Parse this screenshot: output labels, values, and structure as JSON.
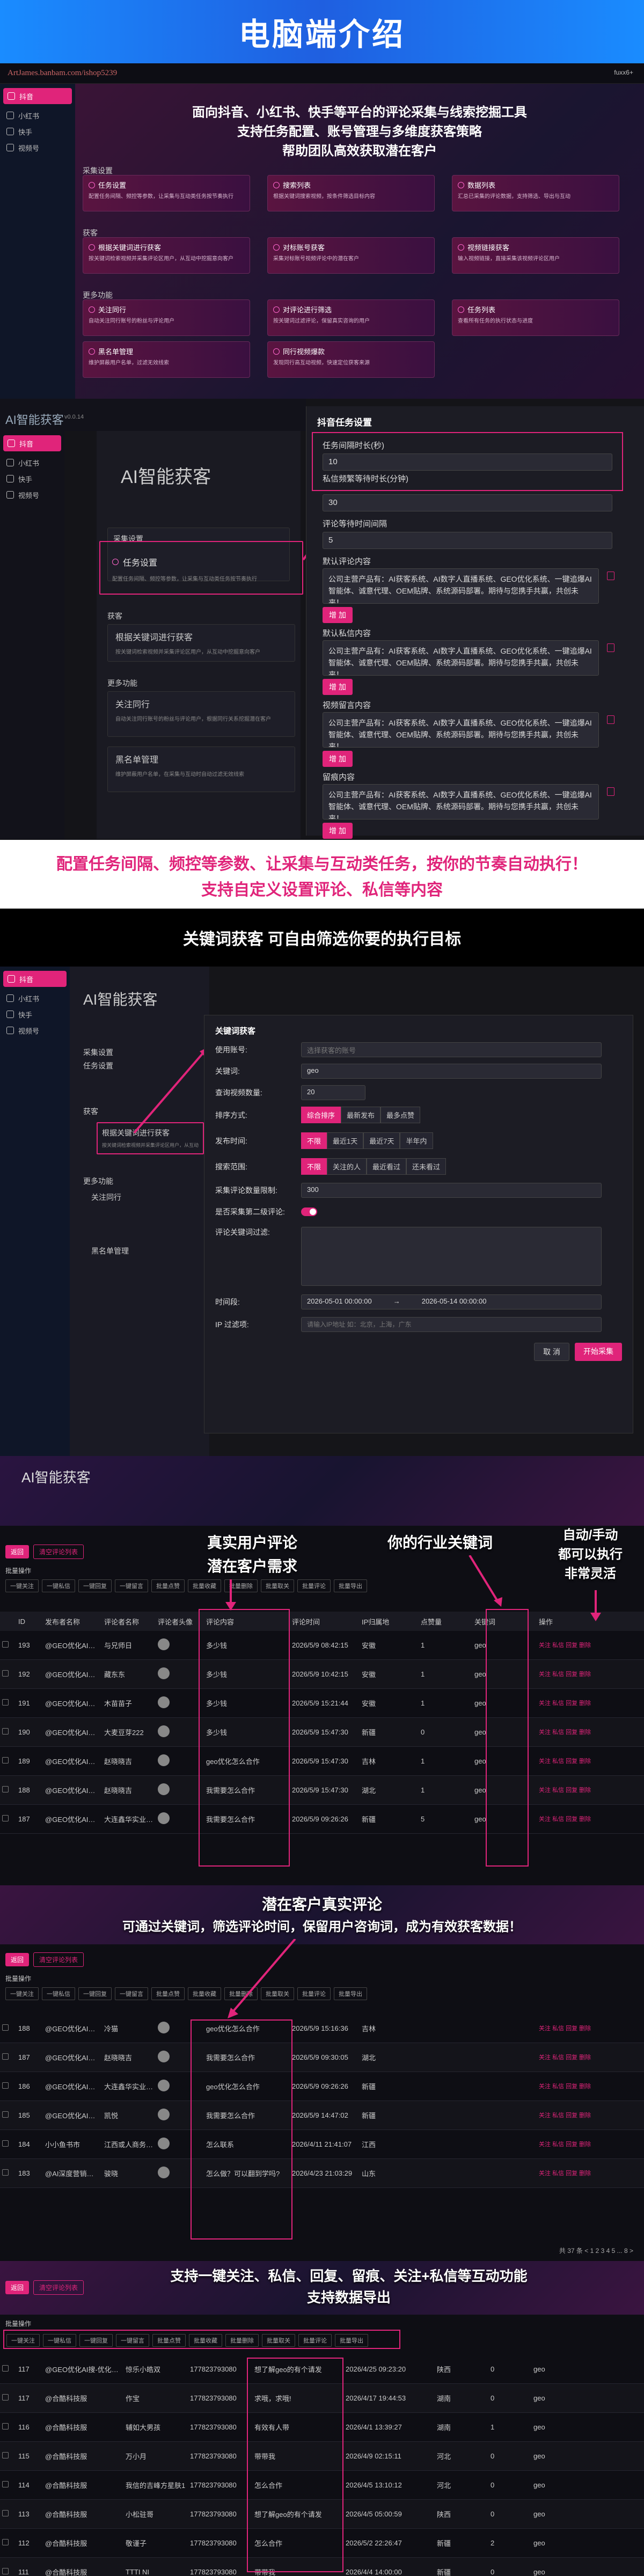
{
  "hero": {
    "title": "电脑端介绍"
  },
  "s1": {
    "url": "ArtJames.banbam.com/ishop5239",
    "user": "fuxx6+",
    "nav": [
      {
        "label": "抖音",
        "active": true
      },
      {
        "label": "小红书",
        "active": false
      },
      {
        "label": "快手",
        "active": false
      },
      {
        "label": "视频号",
        "active": false
      }
    ],
    "banner": [
      "面向抖音、小红书、快手等平台的评论采集与线索挖掘工具",
      "支持任务配置、账号管理与多维度获客策略",
      "帮助团队高效获取潜在客户"
    ],
    "groups": {
      "collect": "采集设置",
      "acquire": "获客",
      "more": "更多功能"
    },
    "cards": [
      {
        "title": "任务设置",
        "desc": "配置任务间隔、频控等参数，让采集与互动类任务按节奏执行"
      },
      {
        "title": "搜索列表",
        "desc": "根据关键词搜索视频，按条件筛选目标内容"
      },
      {
        "title": "数据列表",
        "desc": "汇总已采集的评论数据，支持筛选、导出与互动"
      },
      {
        "title": "根据关键词进行获客",
        "desc": "按关键词检索视频并采集评论区用户，从互动中挖掘意向客户"
      },
      {
        "title": "对标账号获客",
        "desc": "采集对标账号视频评论中的潜在客户"
      },
      {
        "title": "视频链接获客",
        "desc": "输入视频链接，直接采集该视频评论区用户"
      },
      {
        "title": "关注同行",
        "desc": "自动关注同行账号的粉丝与评论用户"
      },
      {
        "title": "对评论进行筛选",
        "desc": "按关键词过滤评论，保留真实咨询的用户"
      },
      {
        "title": "任务列表",
        "desc": "查看所有任务的执行状态与进度"
      },
      {
        "title": "黑名单管理",
        "desc": "维护屏蔽用户名单，过滤无效线索"
      },
      {
        "title": "同行视频爆款",
        "desc": "发现同行高互动视频，快速定位获客来源"
      }
    ]
  },
  "s2": {
    "logo": "AI智能获客",
    "ver": "v0.0.14",
    "title": "AI智能获客",
    "nav": [
      "抖音",
      "小红书",
      "快手",
      "视频号"
    ],
    "mid": {
      "collect": "采集设置",
      "task": "任务设置",
      "task_desc": "配置任务间隔、频控等参数，让采集与互动类任务按节奏执行",
      "acquire": "获客",
      "kw": "根据关键词进行获客",
      "kw_desc": "按关键词检索视频并采集评论区用户，从互动中挖掘意向客户",
      "more": "更多功能",
      "follow": "关注同行",
      "follow_desc": "自动关注同行账号的粉丝与评论用户，根据同行关系挖掘潜在客户",
      "black": "黑名单管理",
      "black_desc": "维护屏蔽用户名单，在采集与互动时自动过滤无效线索"
    },
    "modal": {
      "title": "抖音任务设置",
      "interval_label": "任务间隔时长(秒)",
      "interval_val": "10",
      "private_label": "私信频繁等待时长(分钟)",
      "private_val": "30",
      "comment_wait_label": "评论等待时间间隔",
      "comment_wait_val": "5",
      "default_comment": "默认评论内容",
      "default_private": "默认私信内容",
      "video_msg": "视频留言内容",
      "leave_msg": "留痕内容",
      "text": "公司主营产品有：AI获客系统、AI数字人直播系统、GEO优化系统、一键追爆AI智能体、诚意代理、OEM贴牌、系统源码部署。期待与您携手共赢，共创未来！",
      "add": "增 加"
    },
    "caption": [
      "配置任务间隔、频控等参数、让采集与互动类任务，按你的节奏自动执行！",
      "支持自定义设置评论、私信等内容"
    ]
  },
  "s3": {
    "head": "关键词获客   可自由筛选你要的执行目标",
    "title": "AI智能获客",
    "nav": [
      "抖音",
      "小红书",
      "快手",
      "视频号"
    ],
    "modal": {
      "title": "关键词获客",
      "account_label": "使用账号:",
      "account_ph": "选择获客的账号",
      "kw_label": "关键词:",
      "kw_val": "geo",
      "count_label": "查询视频数量:",
      "count_val": "20",
      "sort_label": "排序方式:",
      "sort_opts": [
        "综合排序",
        "最新发布",
        "最多点赞"
      ],
      "time_label": "发布时间:",
      "time_opts": [
        "不限",
        "最近1天",
        "最近7天",
        "半年内"
      ],
      "range_label": "搜索范围:",
      "range_opts": [
        "不限",
        "关注的人",
        "最近看过",
        "还未看过"
      ],
      "cmt_count_label": "采集评论数量限制:",
      "cmt_count_val": "300",
      "second_label": "是否采集第二级评论:",
      "filter_label": "评论关键词过滤:",
      "filter_val": "",
      "timerange_label": "时间段:",
      "start": "2026-05-01 00:00:00",
      "end": "2026-05-14 00:00:00",
      "ip_label": "IP 过滤项:",
      "ip_ph": "请输入IP地址 如：北京，上海，广东",
      "cancel": "取 消",
      "start_btn": "开始采集"
    }
  },
  "s4": {
    "title": "AI智能获客",
    "annot_left": [
      "真实用户评论",
      "潜在客户需求"
    ],
    "annot_mid": "你的行业关键词",
    "annot_right": [
      "自动/手动",
      "都可以执行",
      "非常灵活"
    ],
    "toolbar": [
      "返回",
      "清空评论列表"
    ],
    "batch": "批量操作",
    "filters": [
      "一键关注",
      "一键私信",
      "一键回复",
      "一键留言",
      "批量点赞",
      "批量收藏",
      "批量删除",
      "批量取关",
      "批量评论",
      "批量导出"
    ],
    "headers": [
      "",
      "ID",
      "发布者名称",
      "评论者名称",
      "评论者头像",
      "评论内容",
      "评论时间",
      "IP归属地",
      "点赞量",
      "关键词",
      "操作"
    ],
    "rows": [
      [
        "",
        "193",
        "@GEO优化AI搜索排名",
        "与兄师日",
        "",
        "多少钱",
        "2026/5/9 08:42:15",
        "安徽",
        "1",
        "geo",
        "关注 私信 回复 删除"
      ],
      [
        "",
        "192",
        "@GEO优化AI搜索排名",
        "藏东东",
        "",
        "多少钱",
        "2026/5/9 10:42:15",
        "安徽",
        "1",
        "geo",
        "关注 私信 回复 删除"
      ],
      [
        "",
        "191",
        "@GEO优化AI搜索排名",
        "木苗苗子",
        "",
        "多少钱",
        "2026/5/9 15:21:44",
        "安徽",
        "1",
        "geo",
        "关注 私信 回复 删除"
      ],
      [
        "",
        "190",
        "@GEO优化AI搜索排名",
        "大麦豆芽222",
        "",
        "多少钱",
        "2026/5/9 15:47:30",
        "新疆",
        "0",
        "geo",
        "关注 私信 回复 删除"
      ],
      [
        "",
        "189",
        "@GEO优化AI搜索排名",
        "赵晓晓吉",
        "",
        "geo优化怎么合作",
        "2026/5/9 15:47:30",
        "吉林",
        "1",
        "geo",
        "关注 私信 回复 删除"
      ],
      [
        "",
        "188",
        "@GEO优化AI搜索排名",
        "赵晓晓吉",
        "",
        "我需要怎么合作",
        "2026/5/9 15:47:30",
        "湖北",
        "1",
        "geo",
        "关注 私信 回复 删除"
      ],
      [
        "",
        "187",
        "@GEO优化AI搜索排名",
        "大连鑫华实业商贸有限公司",
        "",
        "我需要怎么合作",
        "2026/5/9 09:26:26",
        "新疆",
        "5",
        "geo",
        "关注 私信 回复 删除"
      ]
    ]
  },
  "s5": {
    "annot": [
      "潜在客户真实评论",
      "可通过关键词，筛选评论时间，保留用户咨询词，成为有效获客数据！"
    ],
    "toolbar": [
      "返回",
      "清空评论列表"
    ],
    "batch": "批量操作",
    "rows": [
      [
        "",
        "188",
        "@GEO优化AI搜索排名",
        "冷猫",
        "",
        "geo优化怎么合作",
        "2026/5/9 15:16:36",
        "吉林",
        "",
        "",
        "关注 私信 回复 删除"
      ],
      [
        "",
        "187",
        "@GEO优化AI搜索排名",
        "赵晓晓吉",
        "",
        "我需要怎么合作",
        "2026/5/9 09:30:05",
        "湖北",
        "",
        "",
        "关注 私信 回复 删除"
      ],
      [
        "",
        "186",
        "@GEO优化AI搜索排名",
        "大连鑫华实业商贸有限公司",
        "",
        "geo优化怎么合作",
        "2026/5/9 09:26:26",
        "新疆",
        "",
        "",
        "关注 私信 回复 删除"
      ],
      [
        "",
        "185",
        "@GEO优化AI搜索排名",
        "凯悦",
        "",
        "我需要怎么合作",
        "2026/5/9 14:47:02",
        "新疆",
        "",
        "",
        "关注 私信 回复 删除"
      ],
      [
        "",
        "184",
        "小小鱼书市",
        "江西或人商务·学历提升主考中",
        "",
        "怎么联系",
        "2026/4/11 21:41:07",
        "江西",
        "",
        "",
        "关注 私信 回复 删除"
      ],
      [
        "",
        "183",
        "@AI深度营销视频AI营销",
        "骏晓",
        "",
        "怎么做？可以翻到学吗?",
        "2026/4/23 21:03:29",
        "山东",
        "",
        "",
        "关注 私信 回复 删除"
      ]
    ],
    "pager": "共 37 条  < 1 2 3 4 5 ... 8 >"
  },
  "s6": {
    "annot": [
      "支持一键关注、私信、回复、留痕、关注+私信等互动功能",
      "支持数据导出"
    ],
    "toolbar": [
      "返回",
      "清空评论列表"
    ],
    "batch": "批量操作",
    "rows": [
      [
        "",
        "117",
        "@GEO优化AI搜-优化排名",
        "惊乐小皓双",
        "177823793080",
        "想了解geo的有个请发",
        "2026/4/25 09:23:20",
        "陕西",
        "0",
        "geo"
      ],
      [
        "",
        "117",
        "@合酷科技服",
        "作宝",
        "177823793080",
        "求哦，求哦!",
        "2026/4/17 19:44:53",
        "湖南",
        "0",
        "geo"
      ],
      [
        "",
        "116",
        "@合酷科技服",
        "辅如大男孩",
        "177823793080",
        "有效有人带",
        "2026/4/1 13:39:27",
        "湖南",
        "1",
        "geo"
      ],
      [
        "",
        "115",
        "@合酷科技服",
        "万小月",
        "177823793080",
        "带带我",
        "2026/4/9 02:15:11",
        "河北",
        "0",
        "geo"
      ],
      [
        "",
        "114",
        "@合酷科技服",
        "我信的吉峰方星肤1",
        "177823793080",
        "怎么合作",
        "2026/4/5 13:10:12",
        "河北",
        "0",
        "geo"
      ],
      [
        "",
        "113",
        "@合酷科技服",
        "小松驻哥",
        "177823793080",
        "想了解geo的有个请发",
        "2026/4/5 05:00:59",
        "陕西",
        "0",
        "geo"
      ],
      [
        "",
        "112",
        "@合酷科技服",
        "敬谨子",
        "177823793080",
        "怎么合作",
        "2026/5/2 22:26:47",
        "新疆",
        "2",
        "geo"
      ],
      [
        "",
        "111",
        "@合酷科技服",
        "TTTI NI",
        "177823793080",
        "带带我",
        "2026/4/4 14:00:00",
        "新疆",
        "0",
        "geo"
      ]
    ]
  }
}
